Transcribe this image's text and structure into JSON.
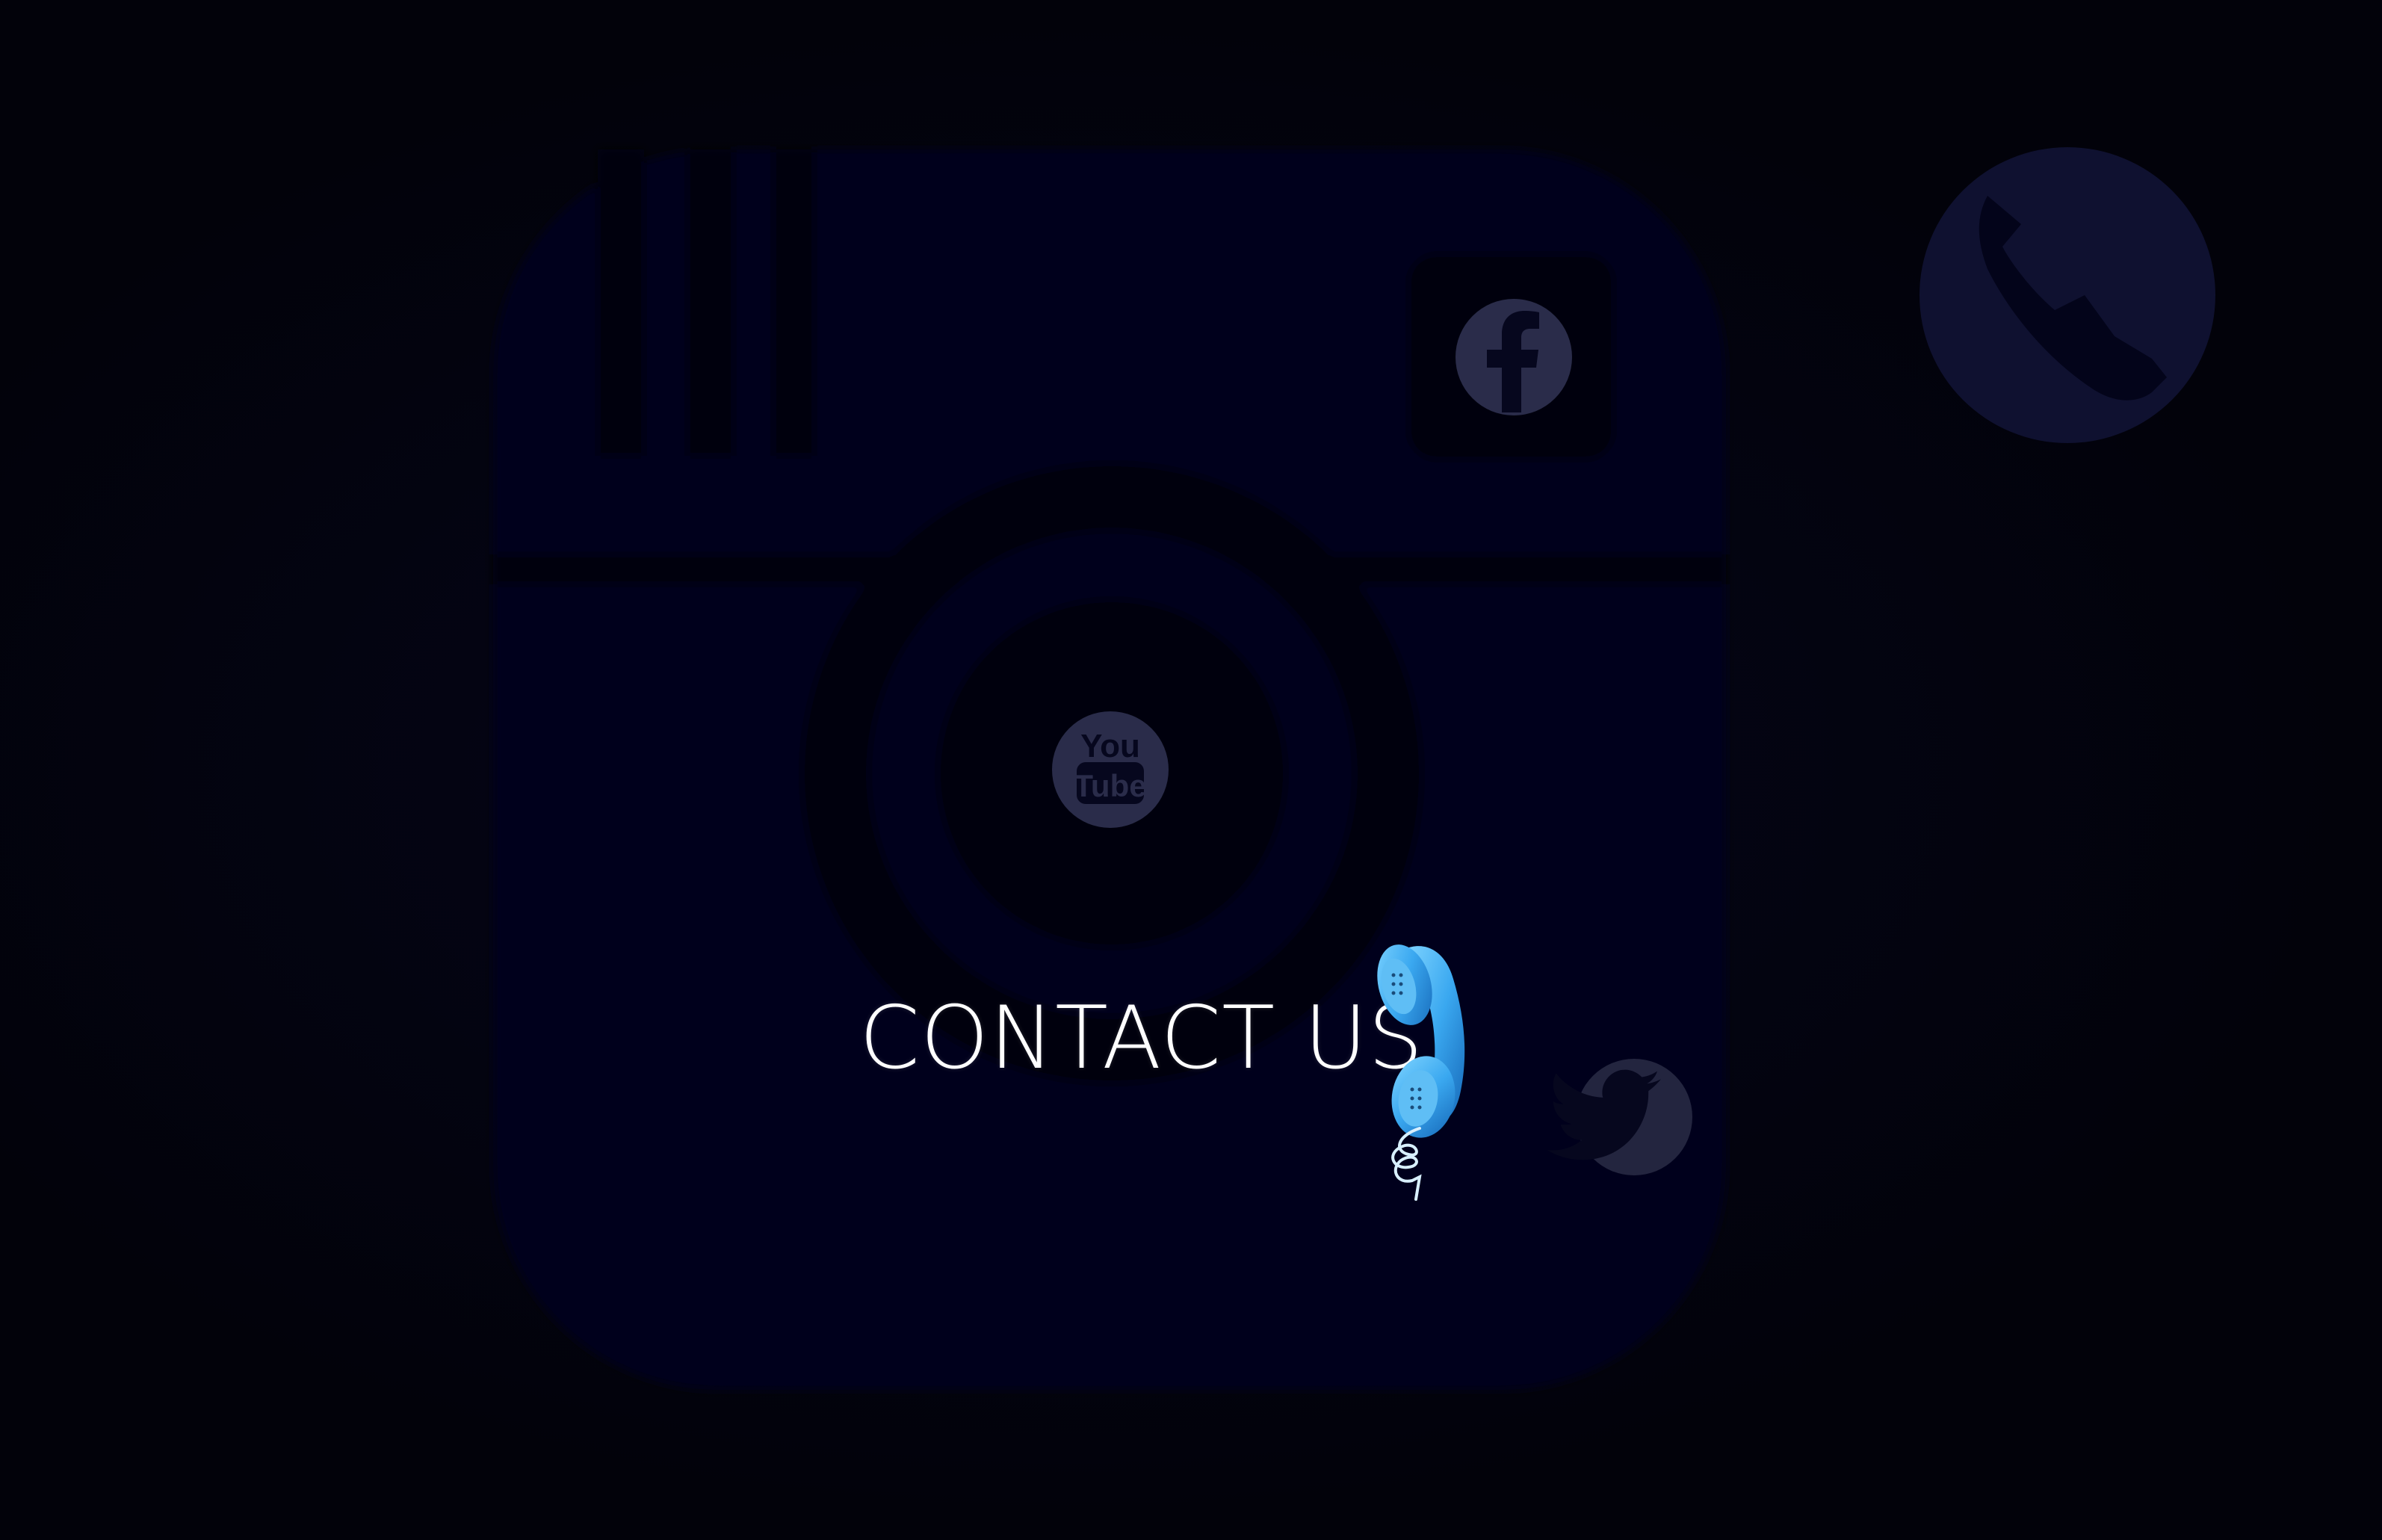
{
  "page": {
    "heading": "CONTACT US"
  },
  "social_links": [
    {
      "icon": "facebook-icon",
      "glyph": "f"
    },
    {
      "icon": "youtube-icon",
      "glyph_top": "You",
      "glyph_bottom": "Tube"
    },
    {
      "icon": "twitter-icon"
    },
    {
      "icon": "phone-icon"
    }
  ],
  "colors": {
    "background": "#02020a",
    "camera_body": "#04051a",
    "icon_circle": "#2a2c4a",
    "icon_glyph": "#06071e",
    "heading_text": "#ffffff",
    "phone_accent": "#3aa8f0"
  }
}
